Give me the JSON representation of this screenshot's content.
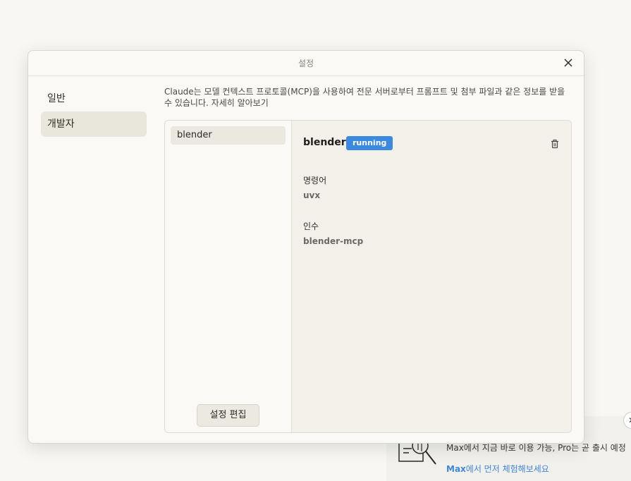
{
  "modal": {
    "title": "설정"
  },
  "sidebar": {
    "items": [
      {
        "label": "일반",
        "active": false
      },
      {
        "label": "개발자",
        "active": true
      }
    ]
  },
  "developer": {
    "description": "Claude는 모델 컨텍스트 프로토콜(MCP)을 사용하여 전문 서버로부터 프롬프트 및 첨부 파일과 같은 정보를 받을 수 있습니다. ",
    "learn_more": "자세히 알아보기",
    "servers": [
      {
        "name": "blender"
      }
    ],
    "edit_config_label": "설정 편집",
    "selected": {
      "name": "blender",
      "status": "running",
      "command_label": "명령어",
      "command_value": "uvx",
      "args_label": "인수",
      "args_value": "blender-mcp"
    }
  },
  "promo": {
    "line1": "Max에서 지금 바로 이용 가능, Pro는 곧 출시 예정",
    "link_strong": "Max",
    "link_rest": "에서 먼저 체험해보세요"
  },
  "colors": {
    "accent": "#3b8ae0",
    "link": "#3f86d9"
  }
}
